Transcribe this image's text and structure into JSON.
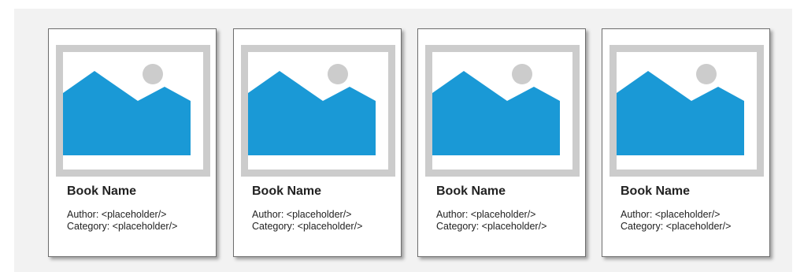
{
  "colors": {
    "panel": "#f2f2f2",
    "frame": "#cccccc",
    "mountain": "#1a99d6",
    "sun": "#cccccc"
  },
  "cards": [
    {
      "icon": "image-placeholder-icon",
      "title": "Book Name",
      "author": "Author: <placeholder/>",
      "category": "Category: <placeholder/>"
    },
    {
      "icon": "image-placeholder-icon",
      "title": "Book Name",
      "author": "Author: <placeholder/>",
      "category": "Category: <placeholder/>"
    },
    {
      "icon": "image-placeholder-icon",
      "title": "Book Name",
      "author": "Author: <placeholder/>",
      "category": "Category: <placeholder/>"
    },
    {
      "icon": "image-placeholder-icon",
      "title": "Book Name",
      "author": "Author: <placeholder/>",
      "category": "Category: <placeholder/>"
    }
  ]
}
